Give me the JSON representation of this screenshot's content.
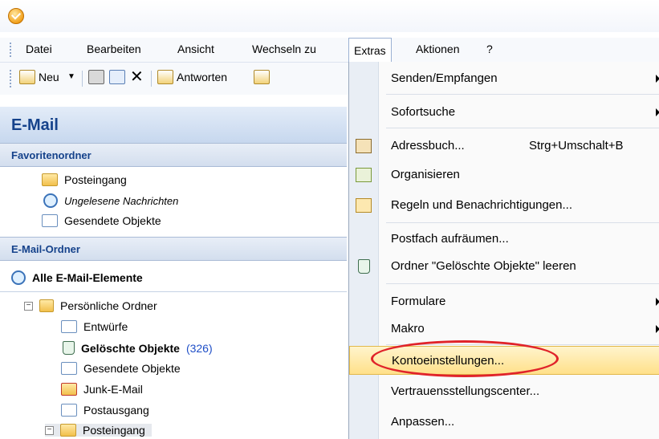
{
  "menubar": {
    "items": [
      "Datei",
      "Bearbeiten",
      "Ansicht",
      "Wechseln zu",
      "Extras",
      "Aktionen",
      "?"
    ],
    "active": "Extras"
  },
  "toolbar": {
    "new_label": "Neu",
    "reply_label": "Antworten"
  },
  "nav": {
    "title": "E-Mail",
    "favorites_header": "Favoritenordner",
    "favorites": [
      {
        "label": "Posteingang",
        "icon": "inbox-icon"
      },
      {
        "label": "Ungelesene Nachrichten",
        "icon": "search-folder-icon"
      },
      {
        "label": "Gesendete Objekte",
        "icon": "sent-items-icon"
      }
    ],
    "mail_folders_header": "E-Mail-Ordner",
    "all_items": "Alle E-Mail-Elemente",
    "personal_folders": "Persönliche Ordner",
    "folders": [
      {
        "label": "Entwürfe",
        "icon": "drafts-icon"
      },
      {
        "label": "Gelöschte Objekte",
        "count": "(326)",
        "icon": "deleted-items-icon"
      },
      {
        "label": "Gesendete Objekte",
        "icon": "sent-items-icon"
      },
      {
        "label": "Junk-E-Mail",
        "icon": "junk-mail-icon"
      },
      {
        "label": "Postausgang",
        "icon": "outbox-icon"
      },
      {
        "label": "Posteingang",
        "icon": "inbox-icon"
      }
    ]
  },
  "extras_menu": {
    "items": [
      {
        "label": "Senden/Empfangen",
        "submenu": true
      },
      {
        "label": "Sofortsuche",
        "submenu": true
      },
      {
        "label": "Adressbuch...",
        "shortcut": "Strg+Umschalt+B"
      },
      {
        "label": "Organisieren"
      },
      {
        "label": "Regeln und Benachrichtigungen..."
      },
      {
        "label": "Postfach aufräumen..."
      },
      {
        "label": "Ordner \"Gelöschte Objekte\" leeren"
      },
      {
        "label": "Formulare",
        "submenu": true
      },
      {
        "label": "Makro",
        "submenu": true
      },
      {
        "label": "Kontoeinstellungen...",
        "highlighted": true
      },
      {
        "label": "Vertrauensstellungscenter..."
      },
      {
        "label": "Anpassen..."
      }
    ]
  },
  "colors": {
    "highlight": "#ffe08a",
    "annotation_circle": "#e0232a",
    "header_text": "#15428b",
    "count_text": "#1f4fc7"
  }
}
